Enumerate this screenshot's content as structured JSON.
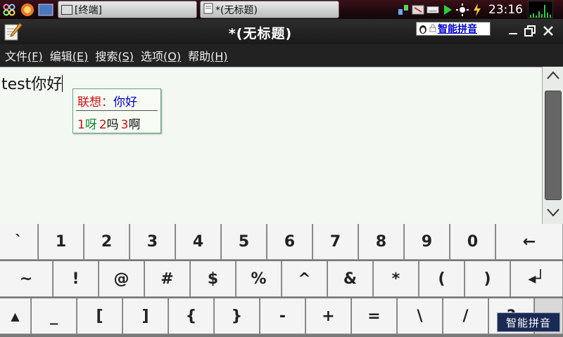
{
  "panel": {
    "taskbar": [
      {
        "label": "[终端]",
        "icon": "terminal-icon"
      },
      {
        "label": "*(无标题)",
        "icon": "editor-icon"
      }
    ],
    "clock": "23:16"
  },
  "window": {
    "title": "*(无标题)",
    "ime_badge": "智能拼音"
  },
  "menu": [
    {
      "label": "文件",
      "key": "(F)"
    },
    {
      "label": "编辑",
      "key": "(E)"
    },
    {
      "label": "搜索",
      "key": "(S)"
    },
    {
      "label": "选项",
      "key": "(O)"
    },
    {
      "label": "帮助",
      "key": "(H)"
    }
  ],
  "editor": {
    "text": "test你好"
  },
  "candidate": {
    "label": "联想：",
    "input": "你好",
    "items": [
      {
        "num": "1",
        "word": "呀"
      },
      {
        "num": "2",
        "word": "吗"
      },
      {
        "num": "3",
        "word": "啊"
      }
    ]
  },
  "keyboard": {
    "row1": [
      "`",
      "1",
      "2",
      "3",
      "4",
      "5",
      "6",
      "7",
      "8",
      "9",
      "0",
      "←"
    ],
    "row2": [
      "~",
      "!",
      "@",
      "#",
      "$",
      "%",
      "^",
      "&",
      "*",
      "(",
      ")",
      "◂┘"
    ],
    "row3": [
      "▲",
      "_",
      "[",
      "]",
      "{",
      "}",
      "-",
      "+",
      "=",
      "\\",
      "/",
      "?",
      "▲"
    ],
    "logo_text": "智能拼音"
  },
  "colors": {
    "panel_bg": "#1e0a0e",
    "editor_bg": "#f3f8f3",
    "candidate_label": "#cc1111",
    "candidate_input": "#0000cc"
  }
}
